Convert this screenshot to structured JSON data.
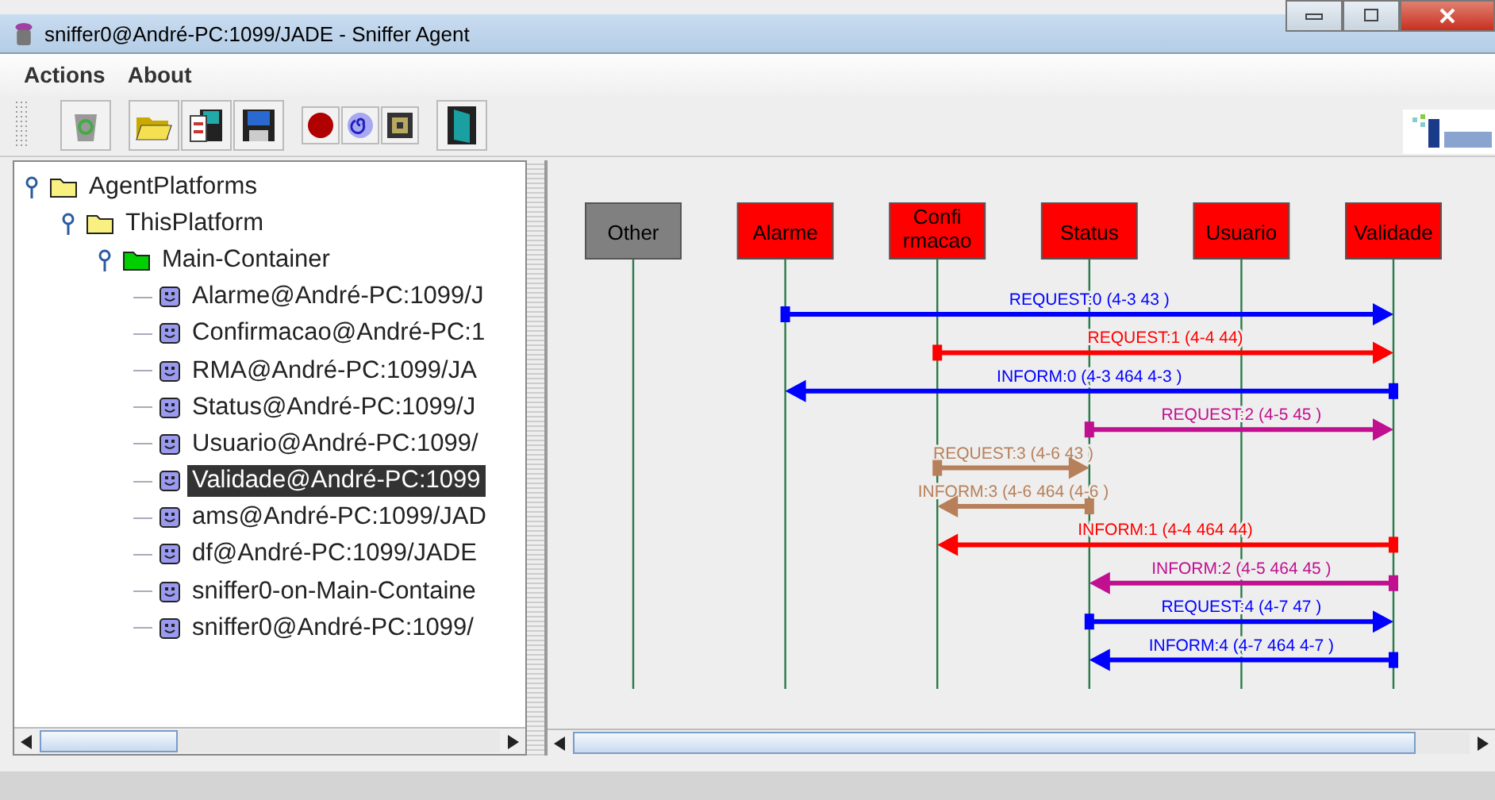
{
  "window": {
    "title": "sniffer0@André-PC:1099/JADE - Sniffer Agent"
  },
  "menu": [
    {
      "label": "Actions"
    },
    {
      "label": "About"
    }
  ],
  "tree": [
    {
      "label": "AgentPlatforms",
      "kind": "folder",
      "expanded": true,
      "selected": false,
      "children": [
        {
          "label": "ThisPlatform",
          "kind": "folder",
          "expanded": true,
          "selected": false,
          "children": [
            {
              "label": "Main-Container",
              "kind": "container",
              "expanded": true,
              "selected": false,
              "children": [
                {
                  "label": "Alarme@André-PC:1099/J",
                  "kind": "agent",
                  "selected": false
                },
                {
                  "label": "Confirmacao@André-PC:1",
                  "kind": "agent",
                  "selected": false
                },
                {
                  "label": "RMA@André-PC:1099/JA",
                  "kind": "agent",
                  "selected": false
                },
                {
                  "label": "Status@André-PC:1099/J",
                  "kind": "agent",
                  "selected": false
                },
                {
                  "label": "Usuario@André-PC:1099/",
                  "kind": "agent",
                  "selected": false
                },
                {
                  "label": "Validade@André-PC:1099",
                  "kind": "agent",
                  "selected": true
                },
                {
                  "label": "ams@André-PC:1099/JAD",
                  "kind": "agent",
                  "selected": false
                },
                {
                  "label": "df@André-PC:1099/JADE",
                  "kind": "agent",
                  "selected": false
                },
                {
                  "label": "sniffer0-on-Main-Containe",
                  "kind": "agent",
                  "selected": false
                },
                {
                  "label": "sniffer0@André-PC:1099/",
                  "kind": "agent",
                  "selected": false
                }
              ]
            }
          ]
        }
      ]
    }
  ],
  "agents": [
    {
      "label_lines": [
        "Other"
      ],
      "color": "#808080"
    },
    {
      "label_lines": [
        "Alarme"
      ],
      "color": "#ff0000"
    },
    {
      "label_lines": [
        "Confi",
        "rmacao"
      ],
      "color": "#ff0000"
    },
    {
      "label_lines": [
        "Status"
      ],
      "color": "#ff0000"
    },
    {
      "label_lines": [
        "Usuario"
      ],
      "color": "#ff0000"
    },
    {
      "label_lines": [
        "Validade"
      ],
      "color": "#ff0000"
    }
  ],
  "messages": [
    {
      "label": "REQUEST:0 (4-3  43 )",
      "color": "#0000ff"
    },
    {
      "label": "REQUEST:1 (4-4  44)",
      "color": "#ff0000"
    },
    {
      "label": "INFORM:0 (4-3  464  4-3 )",
      "color": "#0000ff"
    },
    {
      "label": "REQUEST:2 (4-5  45 )",
      "color": "#c0108f"
    },
    {
      "label": "REQUEST:3 (4-6  43 )",
      "color": "#b8805a"
    },
    {
      "label": "INFORM:3 (4-6  464 (4-6 )",
      "color": "#b8805a"
    },
    {
      "label": "INFORM:1 (4-4  464  44)",
      "color": "#ff0000"
    },
    {
      "label": "INFORM:2 (4-5  464  45 )",
      "color": "#c0108f"
    },
    {
      "label": "REQUEST:4 (4-7  47 )",
      "color": "#0000ff"
    },
    {
      "label": "INFORM:4 (4-7  464  4-7 )",
      "color": "#0000ff"
    }
  ]
}
